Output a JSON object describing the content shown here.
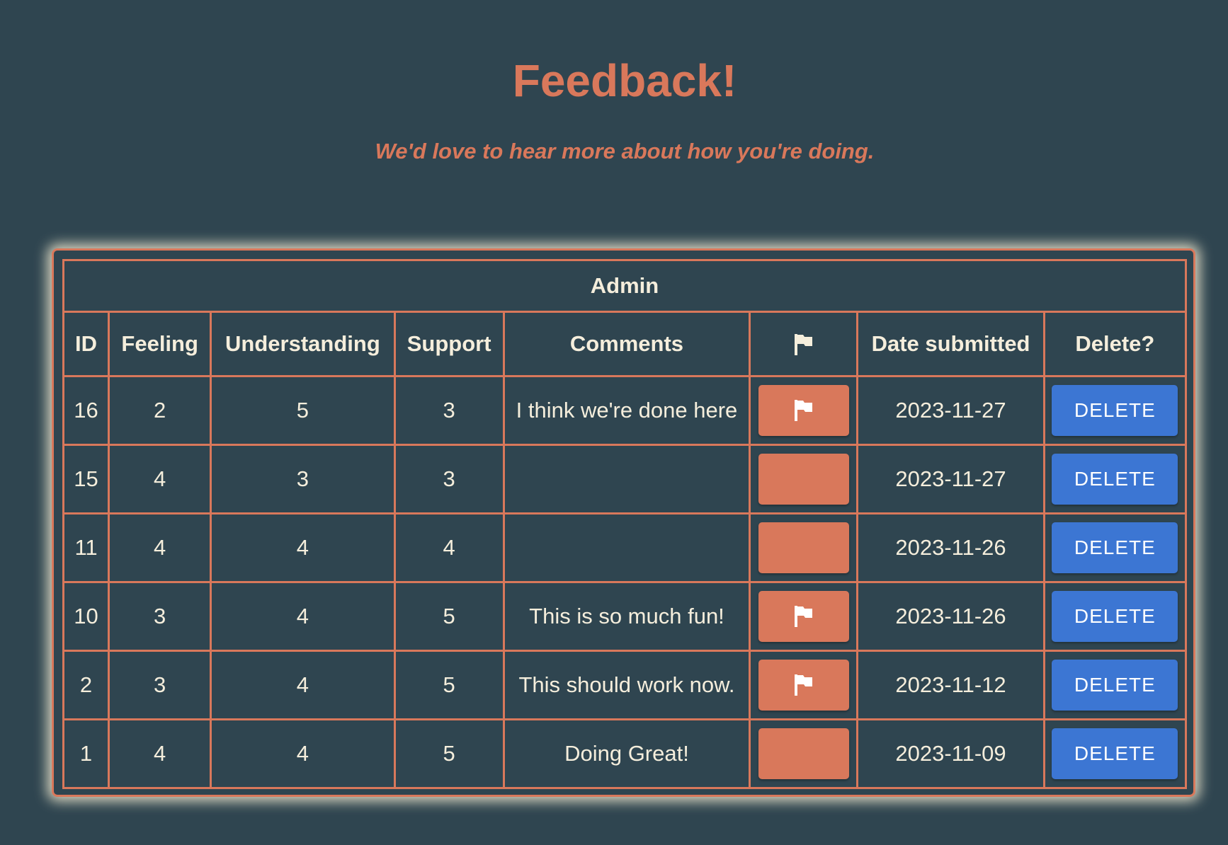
{
  "header": {
    "title": "Feedback!",
    "subtitle": "We'd love to hear more about how you're doing."
  },
  "table": {
    "caption": "Admin",
    "columns": {
      "id": "ID",
      "feeling": "Feeling",
      "understanding": "Understanding",
      "support": "Support",
      "comments": "Comments",
      "flag_icon": "flag-icon",
      "date": "Date submitted",
      "delete": "Delete?"
    },
    "delete_label": "DELETE",
    "rows": [
      {
        "id": "16",
        "feeling": "2",
        "understanding": "5",
        "support": "3",
        "comments": "I think we're done here",
        "flagged": true,
        "date": "2023-11-27"
      },
      {
        "id": "15",
        "feeling": "4",
        "understanding": "3",
        "support": "3",
        "comments": "",
        "flagged": false,
        "date": "2023-11-27"
      },
      {
        "id": "11",
        "feeling": "4",
        "understanding": "4",
        "support": "4",
        "comments": "",
        "flagged": false,
        "date": "2023-11-26"
      },
      {
        "id": "10",
        "feeling": "3",
        "understanding": "4",
        "support": "5",
        "comments": "This is so much fun!",
        "flagged": true,
        "date": "2023-11-26"
      },
      {
        "id": "2",
        "feeling": "3",
        "understanding": "4",
        "support": "5",
        "comments": "This should work now.",
        "flagged": true,
        "date": "2023-11-12"
      },
      {
        "id": "1",
        "feeling": "4",
        "understanding": "4",
        "support": "5",
        "comments": "Doing Great!",
        "flagged": false,
        "date": "2023-11-09"
      }
    ]
  },
  "colors": {
    "background": "#2f4550",
    "accent": "#d9785b",
    "text": "#f5eedc",
    "delete_button": "#3c76d3",
    "glow": "#f8f0d4"
  }
}
